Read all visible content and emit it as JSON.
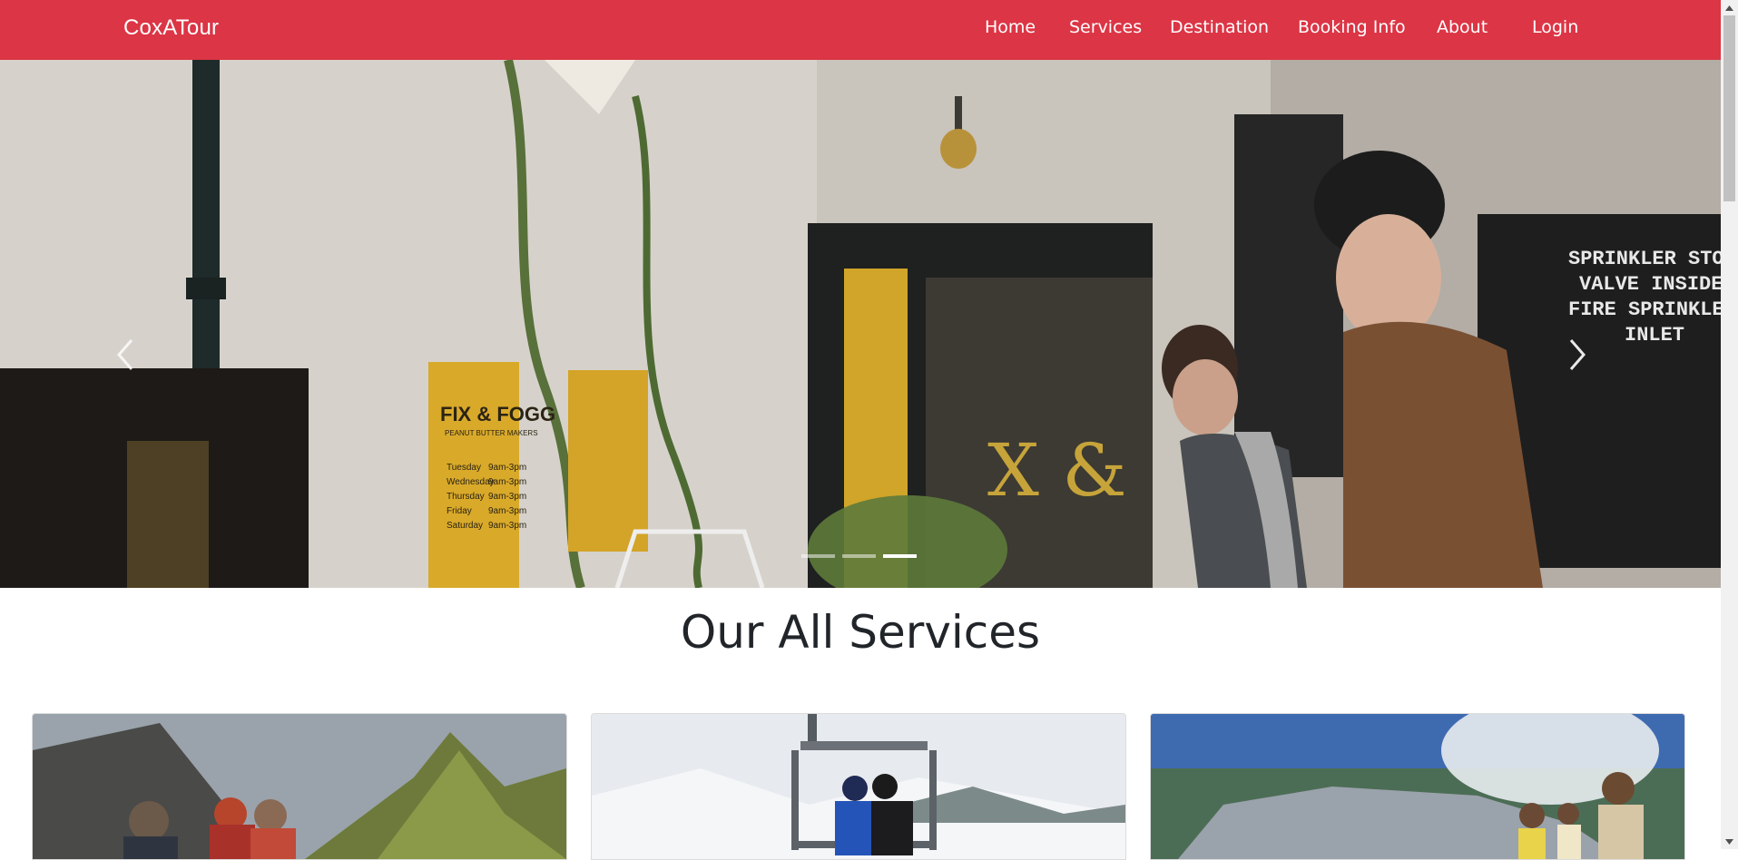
{
  "navbar": {
    "brand": "CoxATour",
    "links": [
      "Home",
      "Services",
      "Destination",
      "Booking Info",
      "About",
      "Login"
    ]
  },
  "carousel": {
    "slide_count": 3,
    "active_index": 2,
    "prev_icon": "chevron-left-icon",
    "next_icon": "chevron-right-icon",
    "sign_title": "FIX & FOGG",
    "sign_subtitle": "PEANUT BUTTER MAKERS",
    "sign_days": [
      "Tuesday",
      "Wednesday",
      "Thursday",
      "Friday",
      "Saturday"
    ],
    "sign_hours": [
      "9am-3pm",
      "9am-3pm",
      "9am-3pm",
      "9am-3pm",
      "9am-3pm"
    ],
    "notice_lines": [
      "SPRINKLER STO",
      "VALVE INSIDE",
      "FIRE SPRINKLE",
      "INLET"
    ],
    "door_letters": "X &"
  },
  "services": {
    "title": "Our All Services"
  },
  "colors": {
    "navbar": "#dc3545",
    "title_text": "#212529"
  }
}
